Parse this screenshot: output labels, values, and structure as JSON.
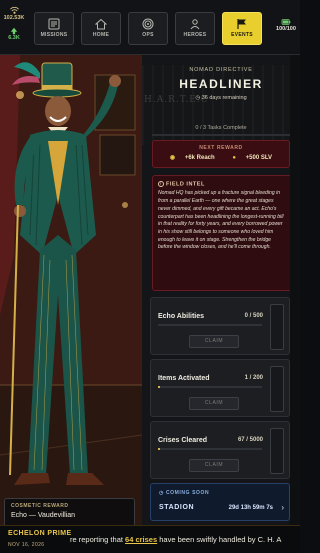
{
  "top_bar": {
    "currency": {
      "value": "102.53K",
      "icon": "wifi-signal-icon",
      "color": "#d9c48a"
    },
    "secondary": {
      "value": "6.3K",
      "icon": "upgrade-arrow-icon",
      "color": "#6fcf6f"
    },
    "energy": {
      "value": "100/100",
      "icon": "battery-icon"
    },
    "tabs": [
      {
        "label": "MISSIONS",
        "icon": "list-icon",
        "active": false
      },
      {
        "label": "HOME",
        "icon": "home-icon",
        "active": false
      },
      {
        "label": "OPS",
        "icon": "target-icon",
        "active": false
      },
      {
        "label": "HEROES",
        "icon": "heroes-icon",
        "active": false
      },
      {
        "label": "EVENTS",
        "icon": "flag-icon",
        "active": true
      }
    ]
  },
  "hero": {
    "cosmetic_label": "COSMETIC REWARD",
    "cosmetic_name": "Echo — Vaudevillian"
  },
  "directive": {
    "subtitle": "NOMAD DIRECTIVE",
    "title": "HEADLINER",
    "days_remaining": "36 days remaining",
    "watermark": "H.A.R.T.E.C",
    "tasks_complete": "0 / 3 Tasks Complete",
    "tasks_fraction": 0
  },
  "next_reward": {
    "label": "NEXT REWARD",
    "items": [
      {
        "text": "+6k Reach",
        "icon": "signal-icon"
      },
      {
        "text": "+500 SLV",
        "icon": "coin-icon"
      }
    ]
  },
  "field_intel": {
    "label": "FIELD INTEL",
    "text": "Nomad HQ has picked up a fracture signal bleeding in from a parallel Earth — one where the great stages never dimmed, and every gift became an act. Echo's counterpart has been headlining the longest-running bill in that reality for forty years, and every borrowed power in his show still belongs to someone who loved him enough to leave it on stage. Strengthen the bridge before the window closes, and he'll come through."
  },
  "progress_cards": [
    {
      "title": "Echo Abilities",
      "value": "0 / 500",
      "fraction": 0,
      "button": "CLAIM"
    },
    {
      "title": "Items Activated",
      "value": "1 / 200",
      "fraction": 0.005,
      "button": "CLAIM"
    },
    {
      "title": "Crises Cleared",
      "value": "67 / 5000",
      "fraction": 0.0134,
      "button": "CLAIM"
    }
  ],
  "coming_soon": {
    "label": "COMING SOON",
    "name": "STADION",
    "timer": "29d 13h 59m 7s"
  },
  "ticker": {
    "org": "ECHELON PRIME",
    "date": "NOV 16, 2026",
    "msg_prefix": "re reporting that ",
    "msg_highlight": "64 crises",
    "msg_suffix": " have been swiftly handled by C. H. A"
  }
}
